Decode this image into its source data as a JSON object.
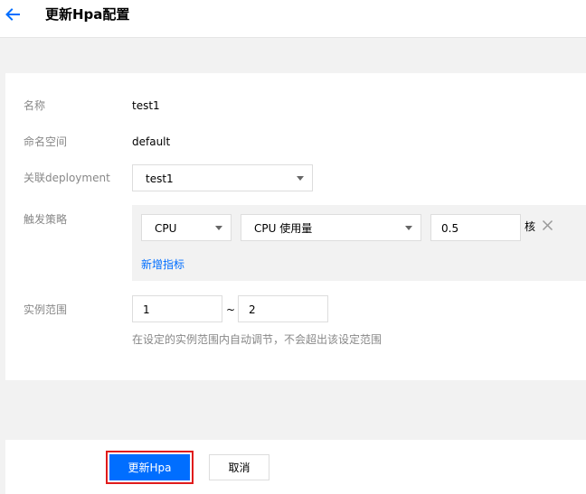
{
  "header": {
    "title": "更新Hpa配置",
    "back_icon": "arrow-left-icon",
    "accent": "#006eff"
  },
  "form": {
    "name": {
      "label": "名称",
      "value": "test1"
    },
    "namespace": {
      "label": "命名空间",
      "value": "default"
    },
    "deployment": {
      "label": "关联deployment",
      "selected": "test1"
    },
    "trigger": {
      "label": "触发策略",
      "resource_selected": "CPU",
      "metric_selected": "CPU 使用量",
      "threshold_value": "0.5",
      "unit": "核",
      "add_metric_label": "新增指标"
    },
    "range": {
      "label": "实例范围",
      "min": "1",
      "separator": "~",
      "max": "2",
      "hint": "在设定的实例范围内自动调节，不会超出该设定范围"
    }
  },
  "footer": {
    "submit_label": "更新Hpa",
    "cancel_label": "取消"
  }
}
